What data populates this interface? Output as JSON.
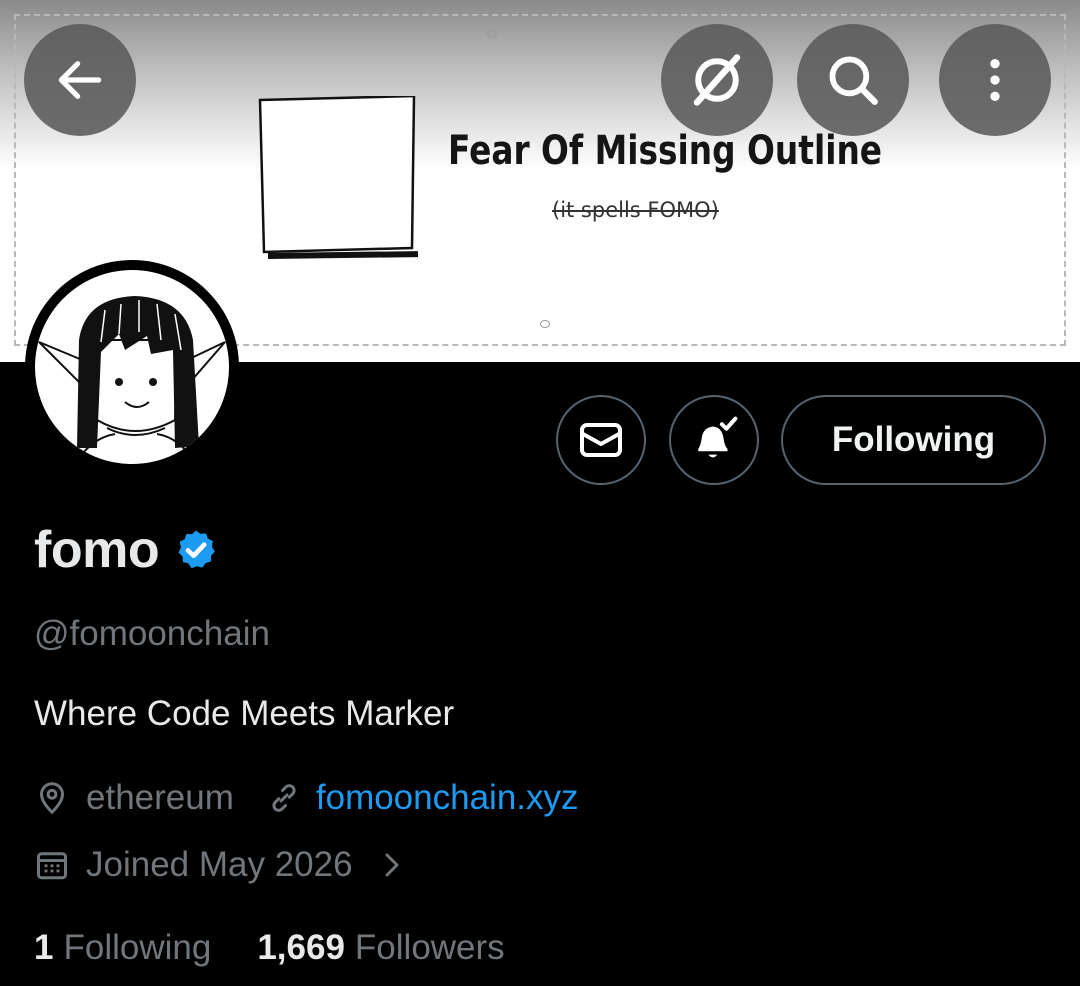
{
  "banner": {
    "title": "Fear Of Missing Outline",
    "subtitle": "(it spells FOMO)"
  },
  "header": {
    "back_icon": "arrow-left-icon",
    "grok_icon": "grok-slash-icon",
    "search_icon": "search-icon",
    "more_icon": "more-vertical-icon"
  },
  "actions": {
    "message_icon": "envelope-icon",
    "notify_icon": "bell-check-icon",
    "follow_label": "Following"
  },
  "profile": {
    "display_name": "fomo",
    "verified": true,
    "verified_color": "#1d9bf0",
    "handle": "@fomoonchain",
    "bio": "Where Code Meets Marker",
    "location": "ethereum",
    "website": "fomoonchain.xyz",
    "joined": "Joined May 2026"
  },
  "stats": {
    "following_count": "1",
    "following_label": "Following",
    "followers_count": "1,669",
    "followers_label": "Followers"
  },
  "colors": {
    "background": "#000000",
    "text_primary": "#e7e9ea",
    "text_secondary": "#71767b",
    "link": "#1d9bf0",
    "button_border": "#536471"
  }
}
